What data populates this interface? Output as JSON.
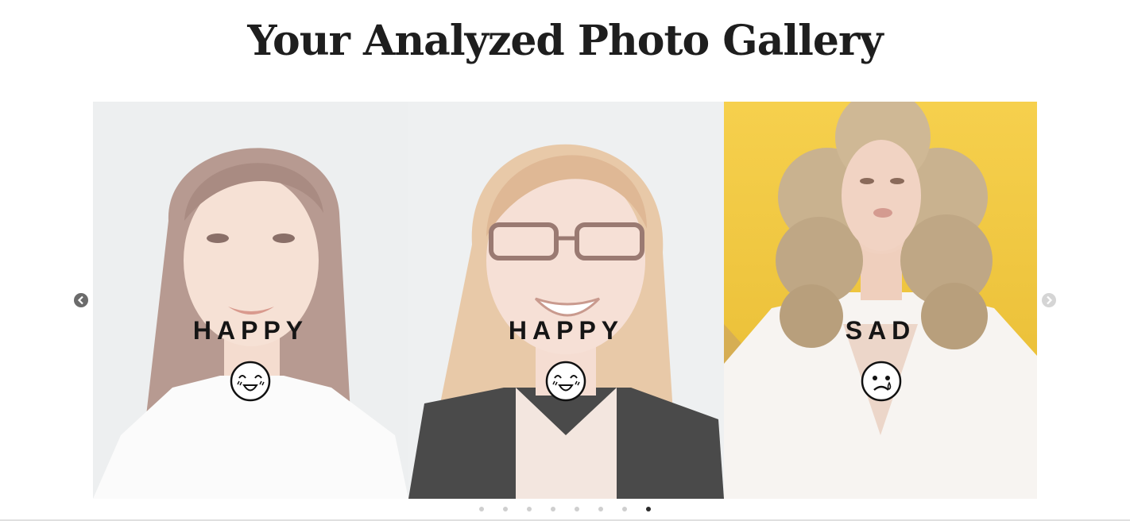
{
  "header": {
    "title": "Your Analyzed Photo Gallery"
  },
  "carousel": {
    "slides": [
      {
        "emotion": "HAPPY",
        "emoji_icon": "happy-face-icon",
        "photo": "woman-dark-hair-white-blouse",
        "background": "#eef0f1"
      },
      {
        "emotion": "HAPPY",
        "emoji_icon": "happy-face-icon",
        "photo": "woman-glasses-blonde-hair",
        "background": "#eef0f1"
      },
      {
        "emotion": "SAD",
        "emoji_icon": "sad-face-icon",
        "photo": "woman-curly-hair-yellow-background",
        "background": "#f4c842"
      }
    ],
    "prev_icon": "chevron-left-circle-icon",
    "next_icon": "chevron-right-circle-icon",
    "pagination": {
      "total": 8,
      "active_index": 7
    }
  }
}
